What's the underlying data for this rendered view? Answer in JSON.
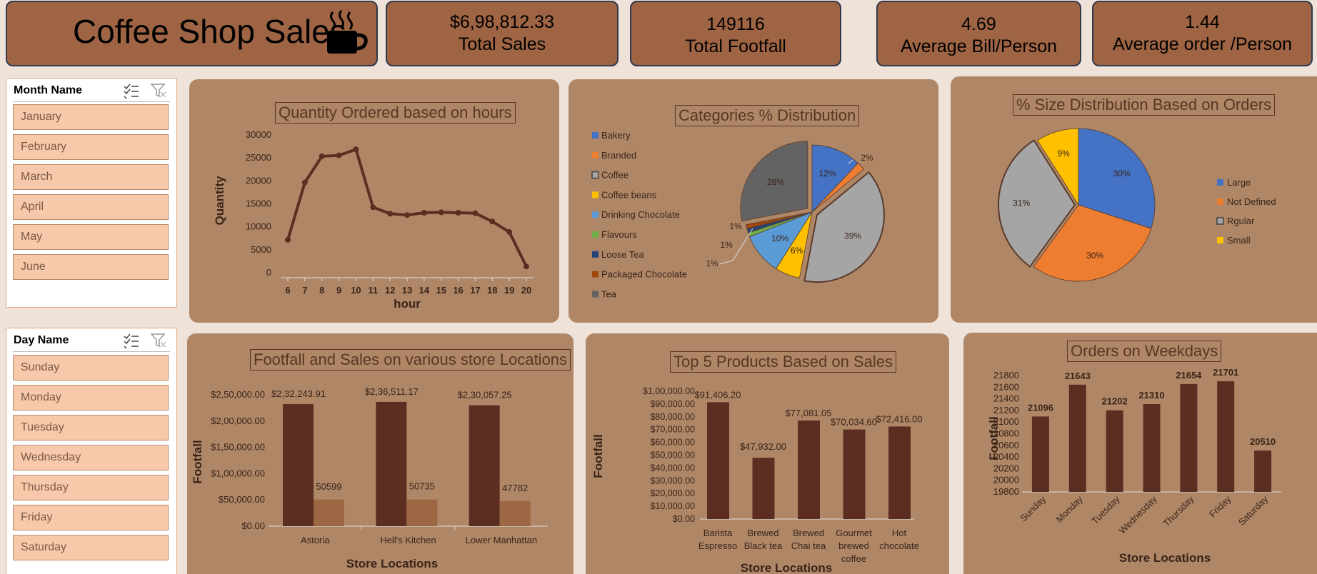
{
  "header": {
    "title": "Coffee Shop Sales",
    "icon": "coffee-cup-icon"
  },
  "kpis": [
    {
      "value": "$6,98,812.33",
      "label": "Total Sales"
    },
    {
      "value": "149116",
      "label": "Total Footfall"
    },
    {
      "value": "4.69",
      "label": "Average Bill/Person"
    },
    {
      "value": "1.44",
      "label": "Average order /Person"
    }
  ],
  "slicers": {
    "month": {
      "title": "Month Name",
      "items": [
        "January",
        "February",
        "March",
        "April",
        "May",
        "June"
      ]
    },
    "day": {
      "title": "Day Name",
      "items": [
        "Sunday",
        "Monday",
        "Tuesday",
        "Wednesday",
        "Thursday",
        "Friday",
        "Saturday"
      ]
    }
  },
  "colors": {
    "bg": "#efe3d9",
    "kpi": "#9f6443",
    "panel": "#af8767",
    "dark_brown": "#5c2e22",
    "light_brown": "#9e6744"
  },
  "chart_data": [
    {
      "type": "line",
      "title": "Quantity Ordered based on hours",
      "xlabel": "hour",
      "ylabel": "Quantity",
      "x": [
        6,
        7,
        8,
        9,
        10,
        11,
        12,
        13,
        14,
        15,
        16,
        17,
        18,
        19,
        20
      ],
      "values": [
        7000,
        19500,
        25200,
        25400,
        26700,
        14100,
        12700,
        12400,
        12900,
        13000,
        12900,
        12800,
        11000,
        8700,
        1200
      ],
      "ylim": [
        0,
        30000
      ],
      "yticks": [
        "0",
        "5000",
        "10000",
        "15000",
        "20000",
        "25000",
        "30000"
      ],
      "grid": false
    },
    {
      "type": "pie",
      "title": "Categories % Distribution",
      "labels": [
        "Bakery",
        "Branded",
        "Coffee",
        "Coffee beans",
        "Drinking Chocolate",
        "Flavours",
        "Loose Tea",
        "Packaged Chocolate",
        "Tea"
      ],
      "values": [
        12,
        2,
        39,
        6,
        10,
        1,
        1,
        1,
        28
      ],
      "data_labels": [
        "12%",
        "2%",
        "39%",
        "6%",
        "10%",
        "1%",
        "1%",
        "1%",
        "28%"
      ],
      "colors": [
        "#4472c4",
        "#ed7d31",
        "#a5a5a5",
        "#ffc000",
        "#5b9bd5",
        "#70ad47",
        "#264478",
        "#9e480e",
        "#636363"
      ],
      "legend": "left"
    },
    {
      "type": "pie",
      "title": "% Size Distribution Based on Orders",
      "labels": [
        "Large",
        "Not Defined",
        "Rgular",
        "Small"
      ],
      "values": [
        30,
        30,
        31,
        9
      ],
      "data_labels": [
        "30%",
        "30%",
        "31%",
        "9%"
      ],
      "colors": [
        "#4472c4",
        "#ed7d31",
        "#a5a5a5",
        "#ffc000"
      ],
      "legend": "right"
    },
    {
      "type": "bar",
      "title": "Footfall and Sales on various store Locations",
      "xlabel": "Store Locations",
      "ylabel": "Footfall",
      "categories": [
        "Astoria",
        "Hell's Kitchen",
        "Lower Manhattan"
      ],
      "series": [
        {
          "values": [
            232243.91,
            236511.17,
            230057.25
          ],
          "data_labels": [
            "$2,32,243.91",
            "$2,36,511.17",
            "$2,30,057.25"
          ]
        },
        {
          "values": [
            50599,
            50735,
            47782
          ],
          "data_labels": [
            "50599",
            "50735",
            "47782"
          ]
        }
      ],
      "ylim": [
        0,
        250000
      ],
      "yticks": [
        "$0.00",
        "$50,000.00",
        "$1,00,000.00",
        "$1,50,000.00",
        "$2,00,000.00",
        "$2,50,000.00"
      ]
    },
    {
      "type": "bar",
      "title": "Top 5 Products Based on Sales",
      "xlabel": "Store Locations",
      "ylabel": "Footfall",
      "categories": [
        [
          "Barista",
          "Espresso"
        ],
        [
          "Brewed",
          "Black tea"
        ],
        [
          "Brewed",
          "Chai tea"
        ],
        [
          "Gourmet",
          "brewed",
          "coffee"
        ],
        [
          "Hot",
          "chocolate"
        ]
      ],
      "values": [
        91406.2,
        47932.0,
        77081.05,
        70034.6,
        72416.0
      ],
      "data_labels": [
        "$91,406.20",
        "$47,932.00",
        "$77,081.05",
        "$70,034.60",
        "$72,416.00"
      ],
      "ylim": [
        0,
        100000
      ],
      "yticks": [
        "$0.00",
        "$10,000.00",
        "$20,000.00",
        "$30,000.00",
        "$40,000.00",
        "$50,000.00",
        "$60,000.00",
        "$70,000.00",
        "$80,000.00",
        "$90,000.00",
        "$1,00,000.00"
      ]
    },
    {
      "type": "bar",
      "title": "Orders on Weekdays",
      "xlabel": "Store Locations",
      "ylabel": "Footfall",
      "categories": [
        "Sunday",
        "Monday",
        "Tuesday",
        "Wednesday",
        "Thursday",
        "Friday",
        "Saturday"
      ],
      "values": [
        21096,
        21643,
        21202,
        21310,
        21654,
        21701,
        20510
      ],
      "data_labels": [
        "21096",
        "21643",
        "21202",
        "21310",
        "21654",
        "21701",
        "20510"
      ],
      "ylim": [
        19800,
        21800
      ],
      "yticks": [
        "19800",
        "20000",
        "20200",
        "20400",
        "20600",
        "20800",
        "21000",
        "21200",
        "21400",
        "21600",
        "21800"
      ]
    }
  ]
}
